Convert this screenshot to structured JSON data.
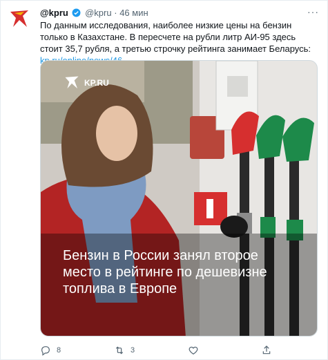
{
  "header": {
    "display_name": "@kpru",
    "handle": "@kpru",
    "separator": "·",
    "time": "46 мин",
    "more": "···"
  },
  "text": {
    "body": "По данным исследования, наиболее низкие цены на бензин только в Казахстане. В пересчете на рубли литр АИ-95 здесь стоит 35,7 рубля, а третью строчку рейтинга занимает Беларусь: ",
    "link": "kp.ru/online/news/46..."
  },
  "media": {
    "logo_text": "KP.RU",
    "headline": "Бензин в России занял второе место в рейтинге по дешевизне топлива в Европе"
  },
  "actions": {
    "reply_count": "8",
    "retweet_count": "3",
    "like_count": "",
    "share_count": ""
  },
  "colors": {
    "verified": "#1d9bf0",
    "link": "#1b95e0",
    "brand_red": "#d62f2f",
    "nozzle_green": "#1d8a4a"
  },
  "icons": {
    "reply": "reply-icon",
    "retweet": "retweet-icon",
    "like": "heart-icon",
    "share": "share-icon",
    "verified": "verified-badge-icon",
    "avatar": "kp-logo-avatar"
  }
}
